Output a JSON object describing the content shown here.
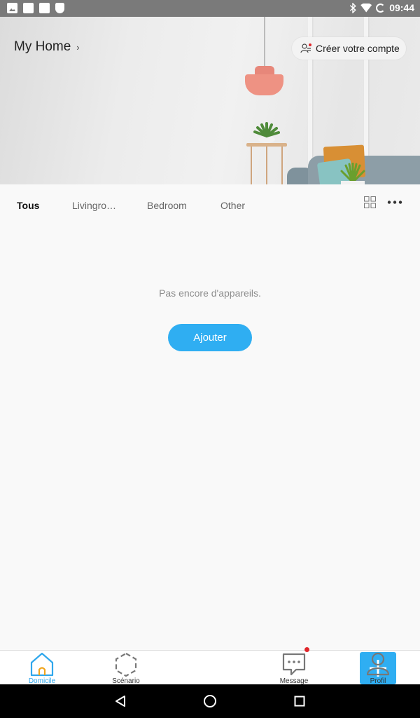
{
  "status_bar": {
    "time": "09:44",
    "left_icons": [
      "image-icon",
      "calendar-icon",
      "download-icon",
      "shield-icon"
    ],
    "right_icons": [
      "bluetooth-icon",
      "wifi-icon",
      "battery-icon"
    ]
  },
  "header": {
    "home_name": "My Home",
    "home_chevron": "›",
    "account_button": "Créer votre compte"
  },
  "tabs": [
    {
      "label": "Tous",
      "active": true
    },
    {
      "label": "Livingro…",
      "active": false
    },
    {
      "label": "Bedroom",
      "active": false
    },
    {
      "label": "Other",
      "active": false
    }
  ],
  "content": {
    "empty_message": "Pas encore d'appareils.",
    "add_button": "Ajouter"
  },
  "bottom_nav": {
    "items": [
      {
        "label": "Domicile",
        "icon": "home-icon",
        "active": true
      },
      {
        "label": "Scénario",
        "icon": "scenario-icon",
        "active": false
      },
      {
        "label": "",
        "icon": "plus-icon",
        "active": false
      },
      {
        "label": "Message",
        "icon": "message-icon",
        "active": false,
        "badge": true
      },
      {
        "label": "Profil",
        "icon": "profile-icon",
        "active": false
      }
    ]
  },
  "colors": {
    "accent": "#2faef2",
    "active_nav": "#2fa7ec",
    "badge": "#e0262b"
  }
}
